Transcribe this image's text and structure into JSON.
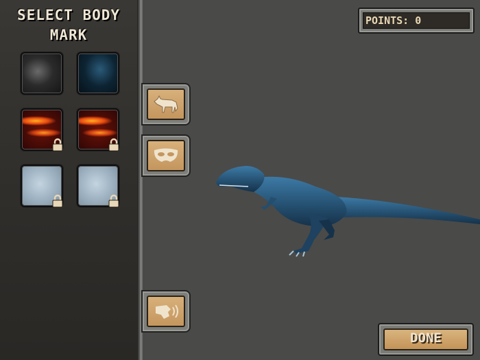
{
  "panel": {
    "title": "SELECT BODY MARK",
    "swatches": [
      {
        "name": "black",
        "locked": false
      },
      {
        "name": "blue",
        "locked": false
      },
      {
        "name": "fire",
        "locked": true
      },
      {
        "name": "fire",
        "locked": true
      },
      {
        "name": "ice",
        "locked": true
      },
      {
        "name": "ice",
        "locked": true
      }
    ]
  },
  "side_tabs": [
    {
      "icon": "wolf-icon"
    },
    {
      "icon": "mask-icon"
    },
    {
      "icon": "roar-icon"
    }
  ],
  "hud": {
    "points_label": "POINTS: 0",
    "done_label": "DONE"
  },
  "colors": {
    "background": "#4a4a48",
    "tab_fill": "#d8b07a",
    "dino_blue": "#2a5f86"
  }
}
